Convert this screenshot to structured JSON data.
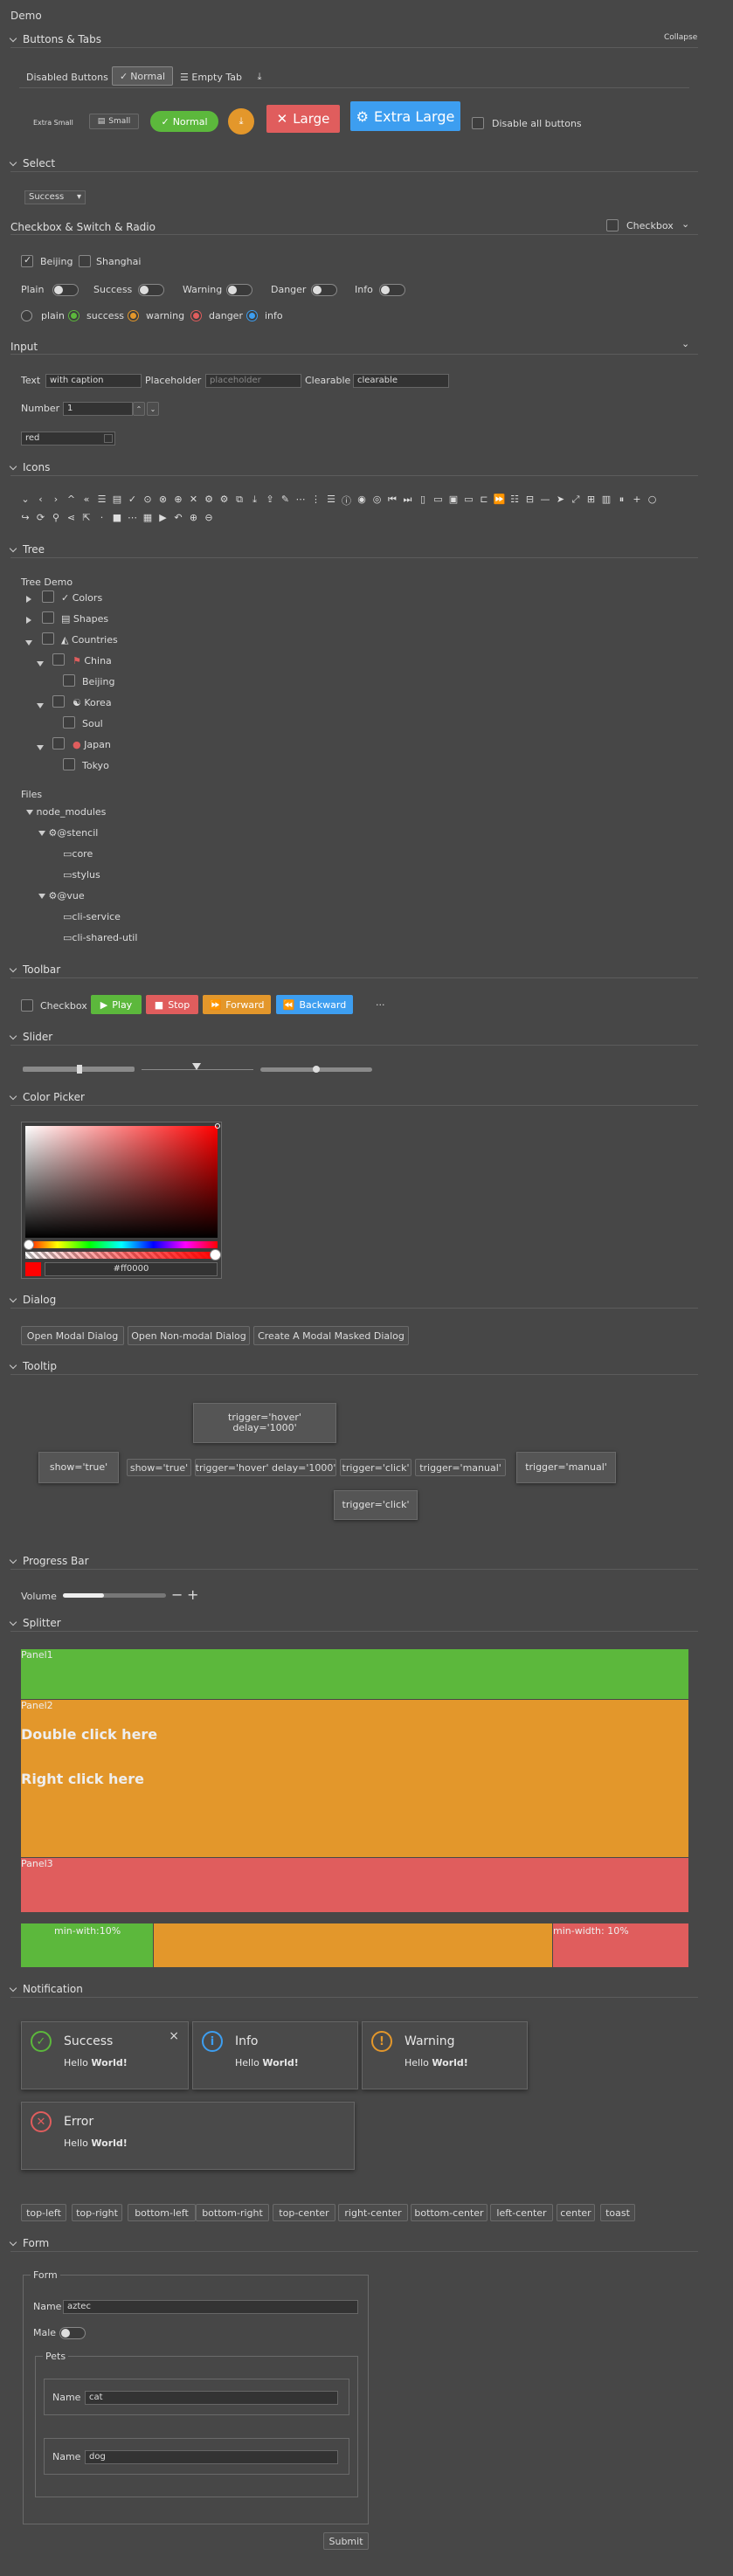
{
  "app": {
    "title": "Demo"
  },
  "sections": {
    "buttons_tabs": "Buttons & Tabs",
    "collapse": "Collapse",
    "select": "Select",
    "checkbox_switch_radio": "Checkbox & Switch & Radio",
    "checkbox_header": "Checkbox",
    "input": "Input",
    "icons": "Icons",
    "tree": "Tree",
    "toolbar": "Toolbar",
    "slider": "Slider",
    "color_picker": "Color Picker",
    "dialog": "Dialog",
    "tooltip": "Tooltip",
    "progress_bar": "Progress Bar",
    "splitter": "Splitter",
    "notification": "Notification",
    "form": "Form"
  },
  "tabs": {
    "disabled": "Disabled Buttons",
    "normal": "Normal",
    "empty": "Empty Tab"
  },
  "buttons": {
    "extra_small": "Extra Small",
    "small": "Small",
    "normal": "Normal",
    "large": "Large",
    "extra_large": "Extra Large",
    "disable_all": "Disable all buttons"
  },
  "select": {
    "value": "Success"
  },
  "checkbox": {
    "beijing": "Beijing",
    "shanghai": "Shanghai"
  },
  "switches": [
    "Plain",
    "Success",
    "Warning",
    "Danger",
    "Info"
  ],
  "radios": [
    "plain",
    "success",
    "warning",
    "danger",
    "info"
  ],
  "input": {
    "text_label": "Text",
    "text_value": "with caption",
    "placeholder_label": "Placeholder",
    "placeholder_text": "placeholder",
    "clearable_label": "Clearable",
    "clearable_value": "clearable",
    "number_label": "Number",
    "number_value": "1",
    "color_value": "red"
  },
  "tree": {
    "demo_title": "Tree Demo",
    "nodes": [
      "Colors",
      "Shapes",
      "Countries",
      "China",
      "Beijing",
      "Korea",
      "Soul",
      "Japan",
      "Tokyo"
    ],
    "files_title": "Files",
    "files": [
      "node_modules",
      "@stencil",
      "core",
      "stylus",
      "@vue",
      "cli-service",
      "cli-shared-util"
    ]
  },
  "toolbar": {
    "checkbox": "Checkbox",
    "play": "Play",
    "stop": "Stop",
    "forward": "Forward",
    "backward": "Backward",
    "more": "···"
  },
  "color_picker": {
    "hex": "#ff0000"
  },
  "dialog": {
    "modal": "Open Modal Dialog",
    "non_modal": "Open Non-modal Dialog",
    "masked": "Create A Modal Masked Dialog"
  },
  "tooltip": {
    "show_true": "show='true'",
    "show_true_tip": "show='true'",
    "hover_delay": "trigger='hover' delay='1000'",
    "hover_delay_tip_1": "trigger='hover'",
    "hover_delay_tip_2": "delay='1000'",
    "click": "trigger='click'",
    "click_tip": "trigger='click'",
    "manual": "trigger='manual'",
    "manual_tip": "trigger='manual'"
  },
  "progress": {
    "volume_label": "Volume",
    "volume_value": 0.4,
    "minus": "−",
    "plus": "+"
  },
  "splitter": {
    "panel1": "Panel1",
    "panel2": "Panel2",
    "panel3": "Panel3",
    "double_click": "Double click here",
    "right_click": "Right click here",
    "min_left": "min-with:10%",
    "min_right": "min-width: 10%"
  },
  "notifications": {
    "success_title": "Success",
    "info_title": "Info",
    "warning_title": "Warning",
    "error_title": "Error",
    "body_prefix": "Hello ",
    "body_bold": "World!",
    "close": "×"
  },
  "positions": [
    "top-left",
    "top-right",
    "bottom-left",
    "bottom-right",
    "top-center",
    "right-center",
    "bottom-center",
    "left-center",
    "center",
    "toast"
  ],
  "form": {
    "legend": "Form",
    "name_label": "Name",
    "name_value": "aztec",
    "male_label": "Male",
    "pets_legend": "Pets",
    "pet1_label": "Name",
    "pet1_value": "cat",
    "pet2_label": "Name",
    "pet2_value": "dog",
    "submit": "Submit"
  },
  "colors": {
    "success": "#5cb83c",
    "warning": "#e3972b",
    "danger": "#e05d5d",
    "info": "#3d9ef0",
    "bg": "#474747"
  }
}
